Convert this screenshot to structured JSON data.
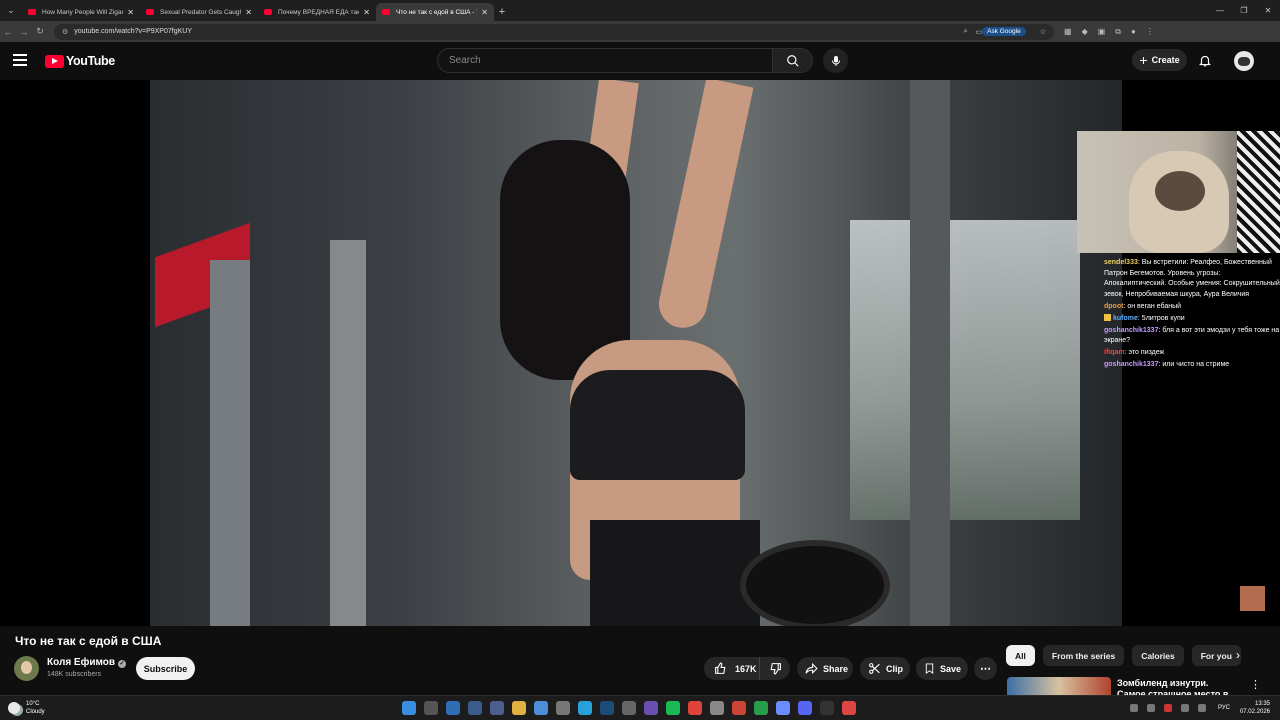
{
  "browser": {
    "tabs": [
      {
        "title": "How Many People Will Zigant",
        "active": false
      },
      {
        "title": "Sexual Predator Gets Caught",
        "active": false
      },
      {
        "title": "Почему ВРЕДНАЯ ЕДА такая",
        "active": false
      },
      {
        "title": "Что не так с едой в США - You",
        "active": true
      }
    ],
    "url": "youtube.com/watch?v=P9XP07fgKUY",
    "ask_google": "Ask Google"
  },
  "header": {
    "logo_text": "YouTube",
    "search_placeholder": "Search",
    "create_label": "Create"
  },
  "stream_chat": [
    {
      "user": "sendel333",
      "text": "Вы встретили: Реалфео, Божественный Патрон Бегемотов. Уровень угрозы: Апокалиптический. Особые умения: Сокрушительный зевок, Непробиваемая шкура, Аура Величия",
      "color": "u1"
    },
    {
      "user": "dpoot",
      "text": "он веган ебаный",
      "color": "u2"
    },
    {
      "user": "kufome",
      "text": "5литров купи",
      "color": "u3"
    },
    {
      "user": "goshanchik1337",
      "text": "бля а вот эти эмодзи у тебя тоже на экране?",
      "color": "u4"
    },
    {
      "user": "ifiqam",
      "text": "это пиздеж",
      "color": "u5"
    },
    {
      "user": "goshanchik1337",
      "text": "или чисто на стриме",
      "color": "u4"
    }
  ],
  "video": {
    "title": "Что не так с едой в США",
    "channel": "Коля Ефимов",
    "subscribers": "148K subscribers",
    "subscribe_label": "Subscribe",
    "likes": "167K",
    "share_label": "Share",
    "clip_label": "Clip",
    "save_label": "Save"
  },
  "chips": [
    "All",
    "From the series",
    "Calories",
    "For you"
  ],
  "recommendation": {
    "title": "Зомбиленд изнутри. Самое страшное место в США (и в"
  },
  "taskbar": {
    "temp": "10°C",
    "weather": "Cloudy",
    "lang": "РУС",
    "time": "13:35",
    "date": "07.02.2026"
  }
}
